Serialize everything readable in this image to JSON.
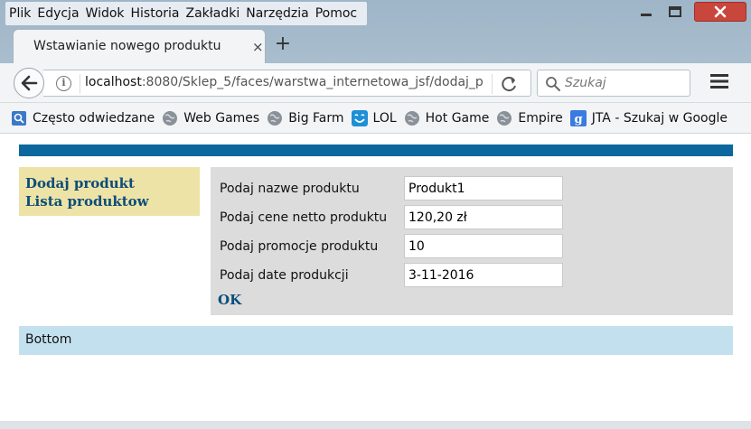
{
  "menubar": {
    "items": [
      {
        "label": "Plik"
      },
      {
        "label": "Edycja"
      },
      {
        "label": "Widok"
      },
      {
        "label": "Historia"
      },
      {
        "label": "Zakładki"
      },
      {
        "label": "Narzędzia"
      },
      {
        "label": "Pomoc"
      }
    ]
  },
  "tab": {
    "title": "Wstawianie nowego produktu",
    "close": "×",
    "new": "+"
  },
  "navbar": {
    "url_host": "localhost",
    "url_rest": ":8080/Sklep_5/faces/warstwa_internetowa_jsf/dodaj_p",
    "search_placeholder": "Szukaj"
  },
  "bookmarks": [
    {
      "label": "Często odwiedzane",
      "icon": "frequent-icon"
    },
    {
      "label": "Web Games",
      "icon": "globe-icon"
    },
    {
      "label": "Big Farm",
      "icon": "globe-icon"
    },
    {
      "label": "LOL",
      "icon": "smiley-icon"
    },
    {
      "label": "Hot Game",
      "icon": "globe-icon"
    },
    {
      "label": "Empire",
      "icon": "globe-icon"
    },
    {
      "label": "JTA - Szukaj w Google",
      "icon": "google-icon"
    }
  ],
  "leftmenu": {
    "add": "Dodaj produkt",
    "list": "Lista produktow"
  },
  "form": {
    "name_label": "Podaj nazwe produktu",
    "name_value": "Produkt1",
    "price_label": "Podaj cene netto produktu",
    "price_value": "120,20 zł",
    "promo_label": "Podaj promocje produktu",
    "promo_value": "10",
    "date_label": "Podaj date produkcji",
    "date_value": "3-11-2016",
    "ok": "OK"
  },
  "footer": {
    "text": "Bottom"
  },
  "colors": {
    "banner": "#0b679d",
    "menu_bg": "#eee3a6",
    "form_bg": "#dcdcdc",
    "footer_bg": "#c3e0ee",
    "link": "#0b4d7a"
  }
}
